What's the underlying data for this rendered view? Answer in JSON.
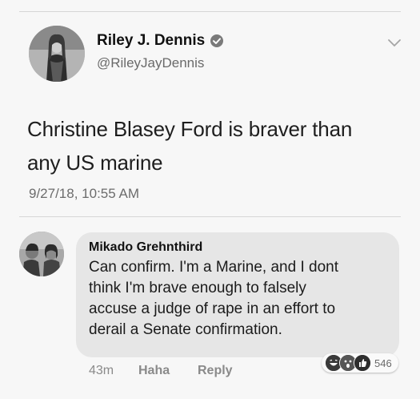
{
  "tweet": {
    "name": "Riley J. Dennis",
    "handle": "@RileyJayDennis",
    "text_line1": "Christine Blasey Ford is braver than",
    "text_line2": "any US marine",
    "timestamp": "9/27/18, 10:55 AM",
    "menu_icon": "chevron-down-icon",
    "verified_icon": "verified-badge-icon"
  },
  "comment": {
    "author": "Mikado Grehnthird",
    "lines": [
      "Can confirm. I'm a Marine, and I dont",
      "think I'm brave enough to falsely",
      "accuse a judge of rape in an effort to",
      "derail a Senate confirmation."
    ],
    "time": "43m",
    "haha_label": "Haha",
    "reply_label": "Reply",
    "reaction_count": "546",
    "reaction_icons": [
      "haha-reaction-icon",
      "wow-reaction-icon",
      "like-reaction-icon"
    ]
  },
  "colors": {
    "background": "#f7f7f7",
    "bubble": "#e6e6e6",
    "muted_text": "#6a6a6a"
  }
}
